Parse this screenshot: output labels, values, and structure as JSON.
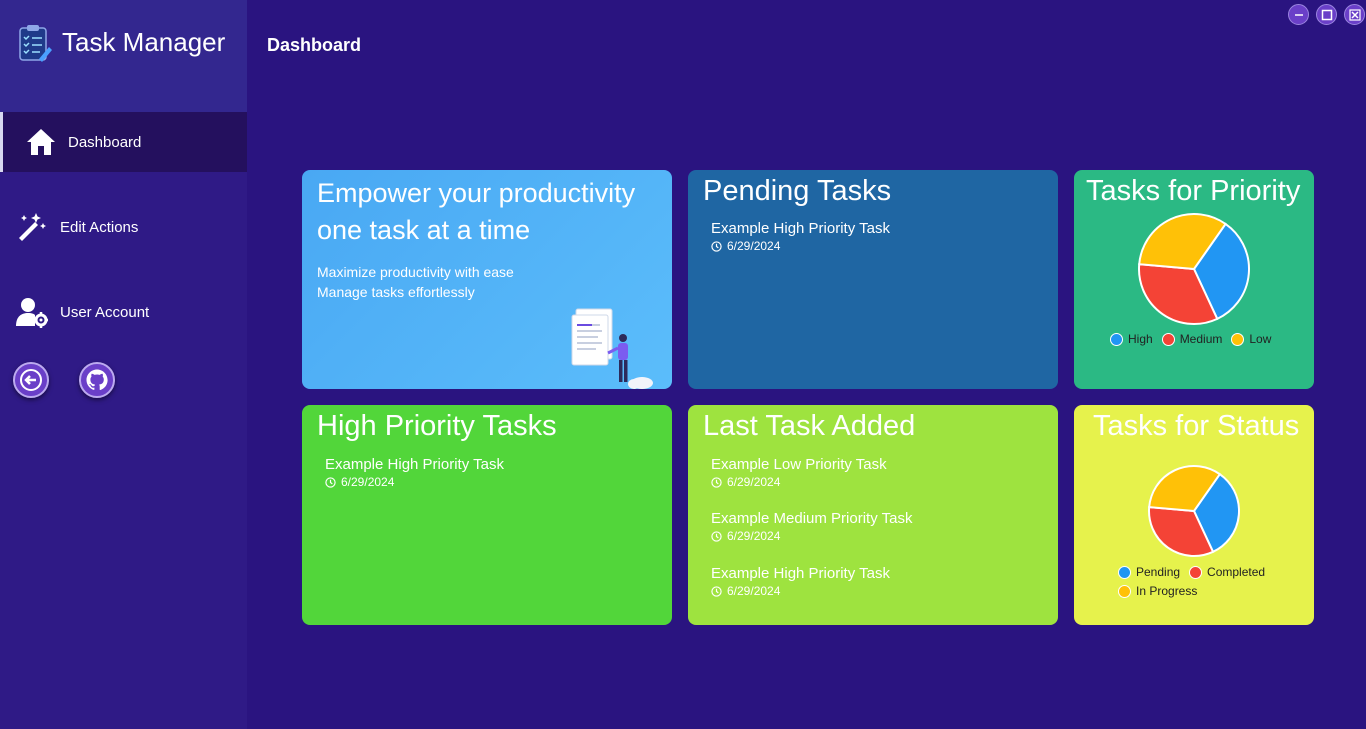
{
  "app": {
    "title": "Task Manager"
  },
  "window_controls": {
    "minimize": "minimize",
    "maximize": "maximize",
    "close": "close"
  },
  "sidebar": {
    "items": [
      {
        "label": "Dashboard",
        "icon": "home-icon"
      },
      {
        "label": "Edit Actions",
        "icon": "magic-wand-icon"
      },
      {
        "label": "User Account",
        "icon": "user-gear-icon"
      }
    ],
    "buttons": [
      {
        "icon": "back-arrow-icon"
      },
      {
        "icon": "github-icon"
      }
    ]
  },
  "page": {
    "title": "Dashboard"
  },
  "hero": {
    "title_line1": "Empower your productivity",
    "title_line2": "one task at a time",
    "subtitle_line1": "Maximize productivity with ease",
    "subtitle_line2": "Manage tasks effortlessly"
  },
  "pending": {
    "title": "Pending Tasks",
    "tasks": [
      {
        "name": "Example High Priority Task",
        "date": "6/29/2024"
      }
    ]
  },
  "priority_chart": {
    "title": "Tasks for Priority",
    "legend": [
      "High",
      "Medium",
      "Low"
    ]
  },
  "high_priority": {
    "title": "High Priority Tasks",
    "tasks": [
      {
        "name": "Example High Priority Task",
        "date": "6/29/2024"
      }
    ]
  },
  "last_added": {
    "title": "Last Task Added",
    "tasks": [
      {
        "name": "Example Low Priority Task",
        "date": "6/29/2024"
      },
      {
        "name": "Example Medium Priority Task",
        "date": "6/29/2024"
      },
      {
        "name": "Example High Priority Task",
        "date": "6/29/2024"
      }
    ]
  },
  "status_chart": {
    "title": "Tasks for Status",
    "legend": [
      "Pending",
      "Completed",
      "In Progress"
    ]
  },
  "colors": {
    "background": "#2a1480",
    "sidebar": "#2f1a86",
    "hero_card": "#4aaff5",
    "pending_card": "#1f66a3",
    "priority_card": "#2bb984",
    "high_card": "#52d63a",
    "last_card": "#9ee33f",
    "status_card": "#e6f24c",
    "slice_blue": "#2196f3",
    "slice_red": "#f44336",
    "slice_yellow": "#ffc107"
  },
  "chart_data": [
    {
      "type": "pie",
      "title": "Tasks for Priority",
      "categories": [
        "High",
        "Medium",
        "Low"
      ],
      "values": [
        1,
        1,
        1
      ]
    },
    {
      "type": "pie",
      "title": "Tasks for Status",
      "categories": [
        "Pending",
        "Completed",
        "In Progress"
      ],
      "values": [
        1,
        1,
        1
      ]
    }
  ]
}
